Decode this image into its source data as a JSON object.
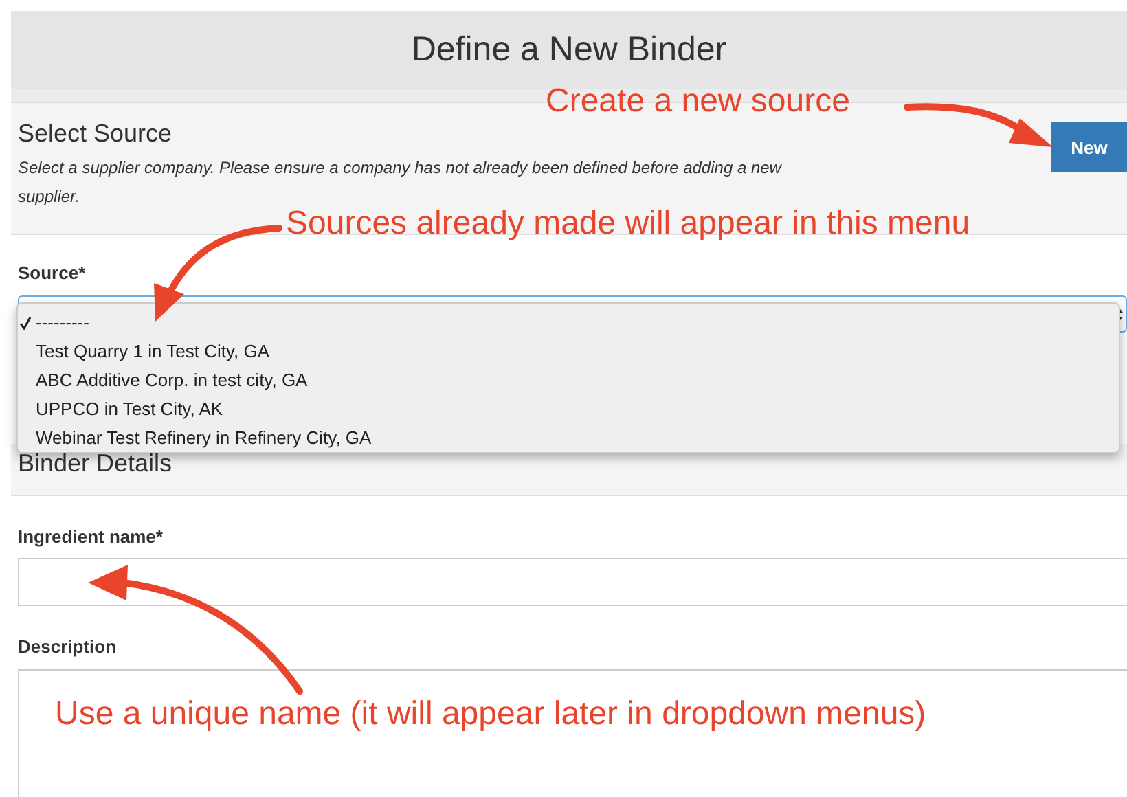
{
  "page_title": "Define a New Binder",
  "select_source": {
    "title": "Select Source",
    "description": "Select a supplier company. Please ensure a company has not already been defined before adding a new supplier.",
    "new_button": "New"
  },
  "source_field": {
    "label": "Source*"
  },
  "source_menu": [
    {
      "label": "---------",
      "selected": true
    },
    {
      "label": "Test Quarry 1 in Test City, GA",
      "selected": false
    },
    {
      "label": "ABC Additive Corp. in test city, GA",
      "selected": false
    },
    {
      "label": "UPPCO in Test City, AK",
      "selected": false
    },
    {
      "label": "Webinar Test Refinery in Refinery City, GA",
      "selected": false
    }
  ],
  "binder_details": {
    "title": "Binder Details"
  },
  "ingredient_name": {
    "label": "Ingredient name*"
  },
  "description": {
    "label": "Description"
  },
  "annotations": [
    {
      "text": "Create a new source"
    },
    {
      "text": "Sources already made will appear in this menu"
    },
    {
      "text": "Use a unique name (it will appear later in dropdown menus)"
    }
  ]
}
